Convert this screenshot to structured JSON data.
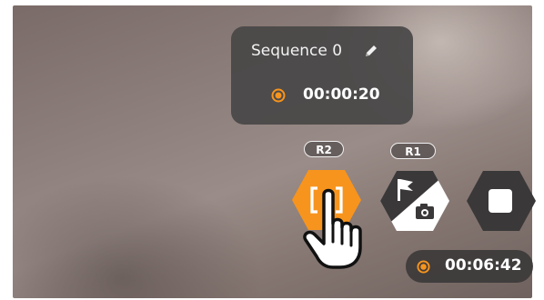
{
  "sequence_panel": {
    "title": "Sequence 0",
    "time": "00:00:20",
    "edit_icon": "pencil-icon",
    "record_icon": "record-dot-icon"
  },
  "controls": {
    "sequence_button": {
      "key": "R2",
      "icon": "brackets-icon",
      "state": "pressed"
    },
    "marker_button": {
      "key": "R1",
      "icon": "flag-camera-icon"
    },
    "stop_button": {
      "icon": "stop-icon"
    }
  },
  "timer": {
    "time": "00:06:42",
    "record_icon": "record-dot-icon"
  },
  "cursor": {
    "icon": "pointing-hand-icon"
  },
  "colors": {
    "accent": "#F7941D",
    "panel_bg": "#484646",
    "button_dark": "#3a3838",
    "text": "#FFFFFF"
  }
}
